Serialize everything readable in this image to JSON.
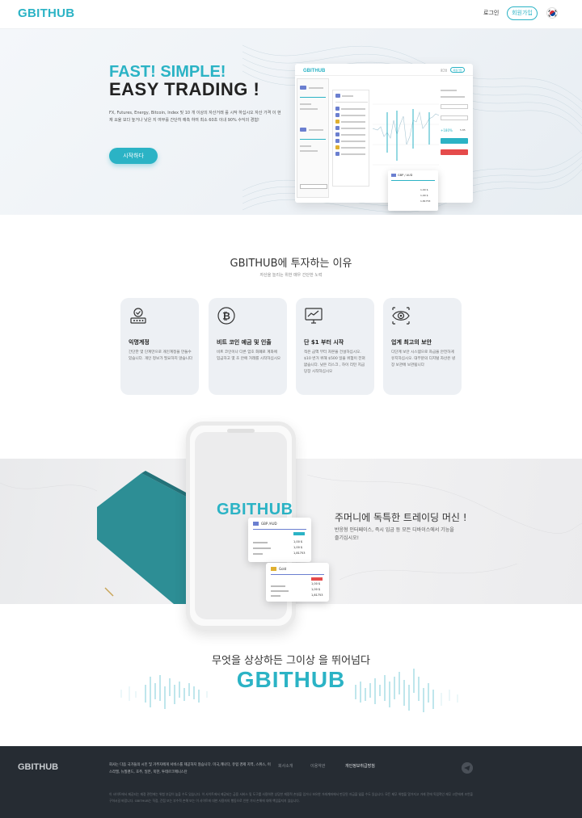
{
  "header": {
    "logo": "GBITHUB",
    "login": "로그인",
    "signup": "회원가입",
    "language_flag": "korea-flag-icon"
  },
  "hero": {
    "title_line1": "FAST! SIMPLE!",
    "title_line2": "EASY TRADING !",
    "description": "FX, Futures, Energy, Bitcoin, Index 및 10 개 이상의 자산거래 를 시작 하십시오 자산 가격 이 현재 요율 보다 높거나 낮은 지 여부를 간단히 예측 하여 최소 60초 이내 90% 수익의 경험!",
    "start_button": "시작하다",
    "mockup": {
      "logo": "GBITHUB",
      "login": "로그인",
      "signup": "회원가입",
      "pair": "GBP / AUD",
      "rate_up": "+180%",
      "amount": "5.85",
      "values": [
        "1,00 $",
        "1,00 $",
        "1,81753"
      ]
    }
  },
  "reasons": {
    "title": "GBITHUB에 투자하는 이유",
    "subtitle": "자산을 늘리는 위한 매우 간단한 노력",
    "cards": [
      {
        "icon": "user-lock-icon",
        "title": "익명계정",
        "desc": "간단한 몇 단계만으로 개인계정을 만들수 있습니다. 개인 정보가 필요하지 않습니다"
      },
      {
        "icon": "bitcoin-icon",
        "title": "비트 코인 예금 및 인출",
        "desc": "비트 코인이나 다른 암호 화폐로 계좌에 입금하고 몇 초 안에 거래를 시작하십시오"
      },
      {
        "icon": "chart-monitor-icon",
        "title": "단 $1 부터 시작",
        "desc": "적은 금액 부터 자본을 건설하십시오. $10 번거 위해 $500 일을 위험이 전혀 없습니다. 낮은 리스크 , 하이 리턴 지금 당장 시작하십시오"
      },
      {
        "icon": "eye-icon",
        "title": "업계 최고의 보안",
        "desc": "디단계 보안 시스템으로 자금을 안전하게 유지하십시오. 대부분의 디지털 자산은 냉장 보관에 보관됩니다"
      }
    ]
  },
  "machine": {
    "phone_logo": "GBITHUB",
    "title": "주머니에 독특한 트레이딩 머신 !",
    "desc": "반응형 인터페이스, 즉시 입금 등 모든 디바이스에서 기능을 즐기십시오!",
    "card1": {
      "pair": "GBP /AUD",
      "v1": "1,00 $",
      "v2": "1,00 $",
      "v3": "1,81753"
    },
    "card2": {
      "pair": "Gold",
      "v1": "1,00 $",
      "v2": "1,00 $",
      "v3": "1,81753"
    }
  },
  "slogan": {
    "text": "무엇을 상상하든 그이상 을 뛰어넘다",
    "logo": "GBITHUB"
  },
  "footer": {
    "logo": "GBITHUB",
    "desc": "회사는 다음 국가들의 시민 및 거주자에게 서비스를 제공하지 않습니다. 미국,캐나다, 유럽 경제 지역, 스위스, 이스라엘, 뉴질랜드, 호주, 일본, 북한, 투테르크메니스탄",
    "links": [
      "회사소개",
      "이용약관",
      "개인정보취급방침"
    ],
    "legal": "이 사이트에서 제공되는 재정 관련에는 위험 부담이 높을 수도 있습니다. 이 사이트에서 제공되는 금융 서비스 및 도구를 사용하면 상당한 재정적 손실을 입거나 보유한 거래계좌에서 펀딩된 자금을 잃을 수도 있습니다. 모든 제무 위험을 알거지고 거래 전에 독립적인 재무 고문에게 조언을 구하시길 바랍니다. GBITHUB는 직접, 간접 또는 부수적 손해 또는 이 사이트에 대한 사용자의 행동으로 인한 기타 손해에 대해 책임을지지 않습니다.",
    "telegram_icon": "telegram-icon"
  },
  "colors": {
    "accent": "#2bb3c5",
    "footer_bg": "#262c33",
    "card_bg": "#edf0f4"
  }
}
